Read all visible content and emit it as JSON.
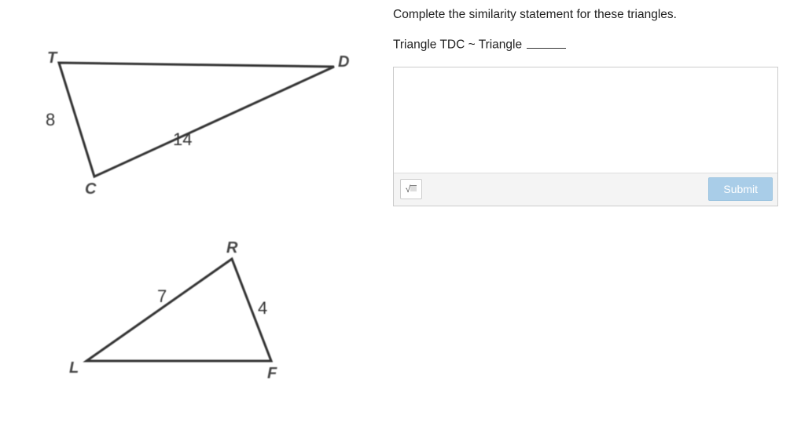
{
  "question": {
    "line1": "Complete the similarity statement for these triangles.",
    "line2_prefix": "Triangle TDC ~ Triangle"
  },
  "triangle1": {
    "vertices": {
      "T": "T",
      "D": "D",
      "C": "C"
    },
    "sides": {
      "TC": "8",
      "DC": "14"
    }
  },
  "triangle2": {
    "vertices": {
      "R": "R",
      "L": "L",
      "F": "F"
    },
    "sides": {
      "LR": "7",
      "RF": "4"
    }
  },
  "controls": {
    "math_symbol": "√",
    "submit_label": "Submit",
    "answer_placeholder": ""
  },
  "chart_data": {
    "type": "diagram",
    "shapes": [
      {
        "name": "Triangle TDC",
        "vertices": [
          "T",
          "D",
          "C"
        ],
        "labeled_sides": [
          {
            "between": [
              "T",
              "C"
            ],
            "length": 8
          },
          {
            "between": [
              "D",
              "C"
            ],
            "length": 14
          }
        ]
      },
      {
        "name": "Triangle LRF",
        "vertices": [
          "L",
          "R",
          "F"
        ],
        "labeled_sides": [
          {
            "between": [
              "L",
              "R"
            ],
            "length": 7
          },
          {
            "between": [
              "R",
              "F"
            ],
            "length": 4
          }
        ]
      }
    ],
    "statement": "Triangle TDC ~ Triangle ___"
  }
}
